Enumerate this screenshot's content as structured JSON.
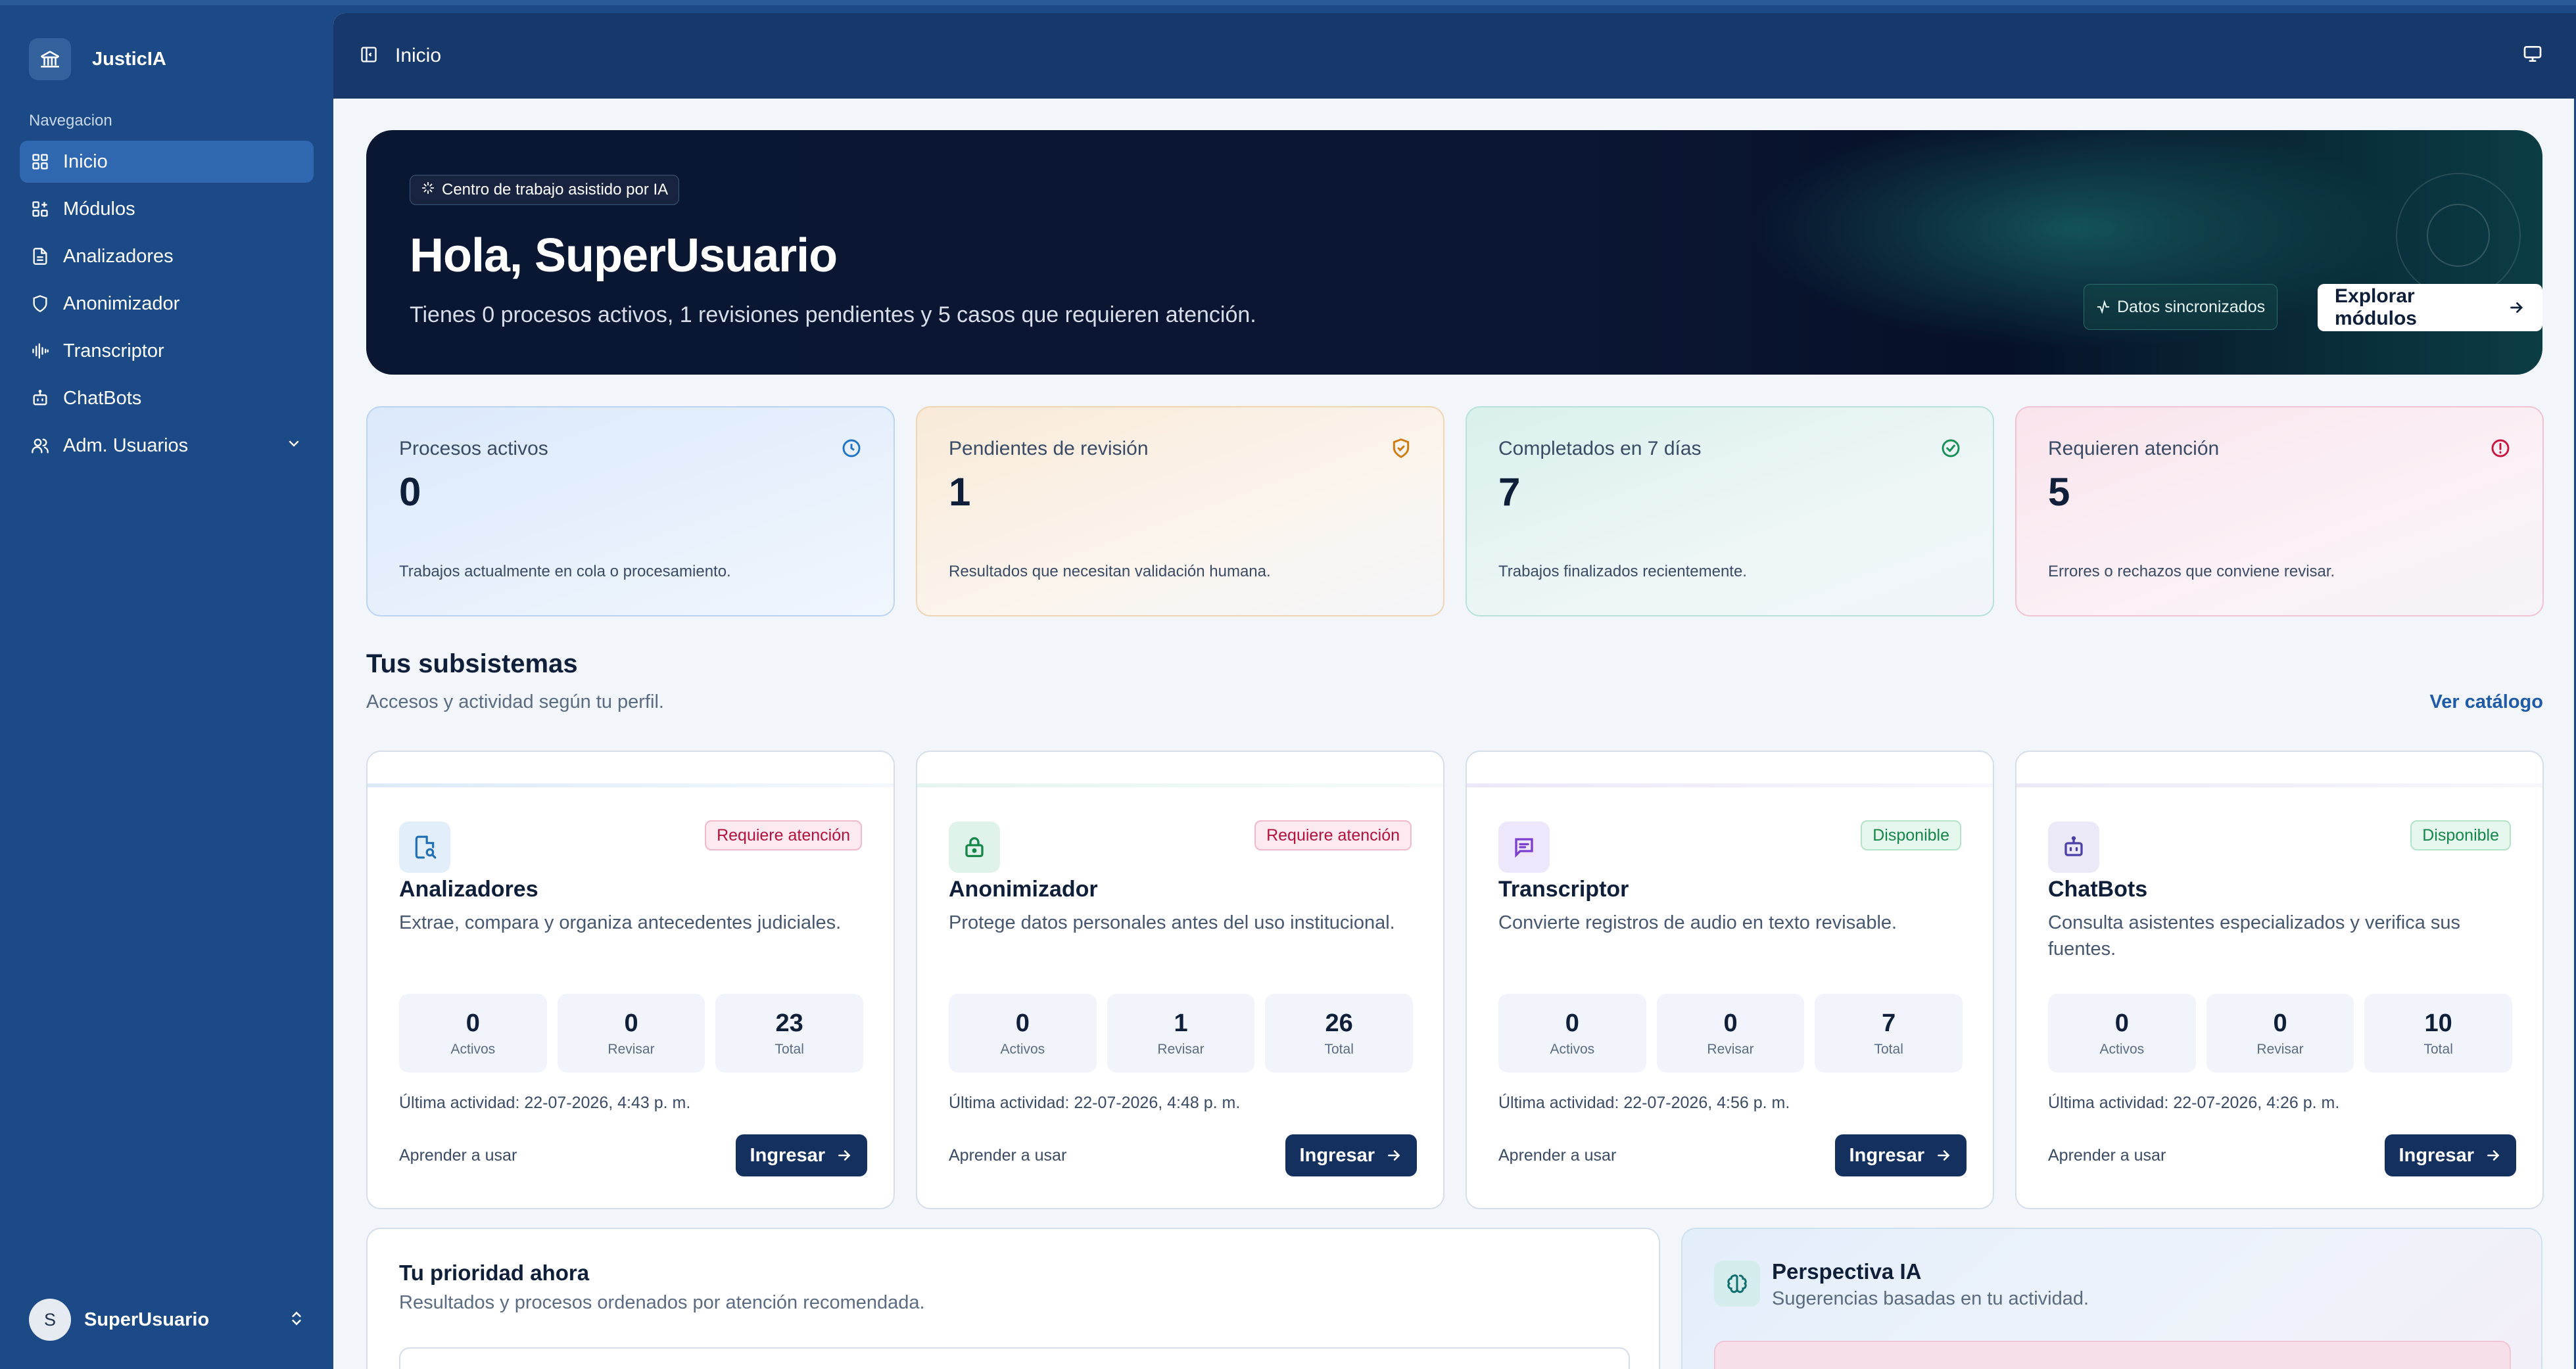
{
  "app": {
    "name": "JusticIA"
  },
  "sidebar": {
    "heading": "Navegacion",
    "items": [
      {
        "label": "Inicio",
        "icon": "grid-icon",
        "active": true
      },
      {
        "label": "Módulos",
        "icon": "modules-icon"
      },
      {
        "label": "Analizadores",
        "icon": "document-icon"
      },
      {
        "label": "Anonimizador",
        "icon": "shield-icon"
      },
      {
        "label": "Transcriptor",
        "icon": "audio-wave-icon"
      },
      {
        "label": "ChatBots",
        "icon": "bot-icon"
      },
      {
        "label": "Adm. Usuarios",
        "icon": "users-icon",
        "expandable": true
      }
    ],
    "user": {
      "initial": "S",
      "name": "SuperUsuario"
    }
  },
  "topbar": {
    "title": "Inicio"
  },
  "hero": {
    "badge": "Centro de trabajo asistido por IA",
    "title": "Hola, SuperUsuario",
    "subtitle": "Tienes 0 procesos activos, 1 revisiones pendientes y 5 casos que requieren atención.",
    "sync_label": "Datos sincronizados",
    "explore_label": "Explorar módulos"
  },
  "stats": [
    {
      "label": "Procesos activos",
      "value": "0",
      "desc": "Trabajos actualmente en cola o procesamiento.",
      "color": "#1f74c8",
      "icon": "clock-icon"
    },
    {
      "label": "Pendientes de revisión",
      "value": "1",
      "desc": "Resultados que necesitan validación humana.",
      "color": "#d27a12",
      "icon": "shield-check-icon"
    },
    {
      "label": "Completados en 7 días",
      "value": "7",
      "desc": "Trabajos finalizados recientemente.",
      "color": "#159056",
      "icon": "check-circle-icon"
    },
    {
      "label": "Requieren atención",
      "value": "5",
      "desc": "Errores o rechazos que conviene revisar.",
      "color": "#c8163f",
      "icon": "alert-circle-icon"
    }
  ],
  "subsystems": {
    "title": "Tus subsistemas",
    "subtitle": "Accesos y actividad según tu perfil.",
    "catalog_link": "Ver catálogo",
    "metric_labels": [
      "Activos",
      "Revisar",
      "Total"
    ],
    "learn_label": "Aprender a usar",
    "enter_label": "Ingresar",
    "items": [
      {
        "name": "Analizadores",
        "desc": "Extrae, compara y organiza antecedentes judiciales.",
        "status": "Requiere atención",
        "metrics": [
          "0",
          "0",
          "23"
        ],
        "last": "Última actividad: 22-07-2026, 4:43 p. m.",
        "icon": "document-scan-icon"
      },
      {
        "name": "Anonimizador",
        "desc": "Protege datos personales antes del uso institucional.",
        "status": "Requiere atención",
        "metrics": [
          "0",
          "1",
          "26"
        ],
        "last": "Última actividad: 22-07-2026, 4:48 p. m.",
        "icon": "lock-icon"
      },
      {
        "name": "Transcriptor",
        "desc": "Convierte registros de audio en texto revisable.",
        "status": "Disponible",
        "metrics": [
          "0",
          "0",
          "7"
        ],
        "last": "Última actividad: 22-07-2026, 4:56 p. m.",
        "icon": "message-icon"
      },
      {
        "name": "ChatBots",
        "desc": "Consulta asistentes especializados y verifica sus fuentes.",
        "status": "Disponible",
        "metrics": [
          "0",
          "0",
          "10"
        ],
        "last": "Última actividad: 22-07-2026, 4:26 p. m.",
        "icon": "bot-icon"
      }
    ]
  },
  "priority": {
    "title": "Tu prioridad ahora",
    "subtitle": "Resultados y procesos ordenados por atención recomendada."
  },
  "perspective": {
    "title": "Perspectiva IA",
    "subtitle": "Sugerencias basadas en tu actividad."
  },
  "colors": {
    "sidebar": "#1b4a86",
    "topbar": "#17386b",
    "active_item": "#2f67b0",
    "primary_button": "#14305f",
    "link": "#1e5aa8"
  }
}
